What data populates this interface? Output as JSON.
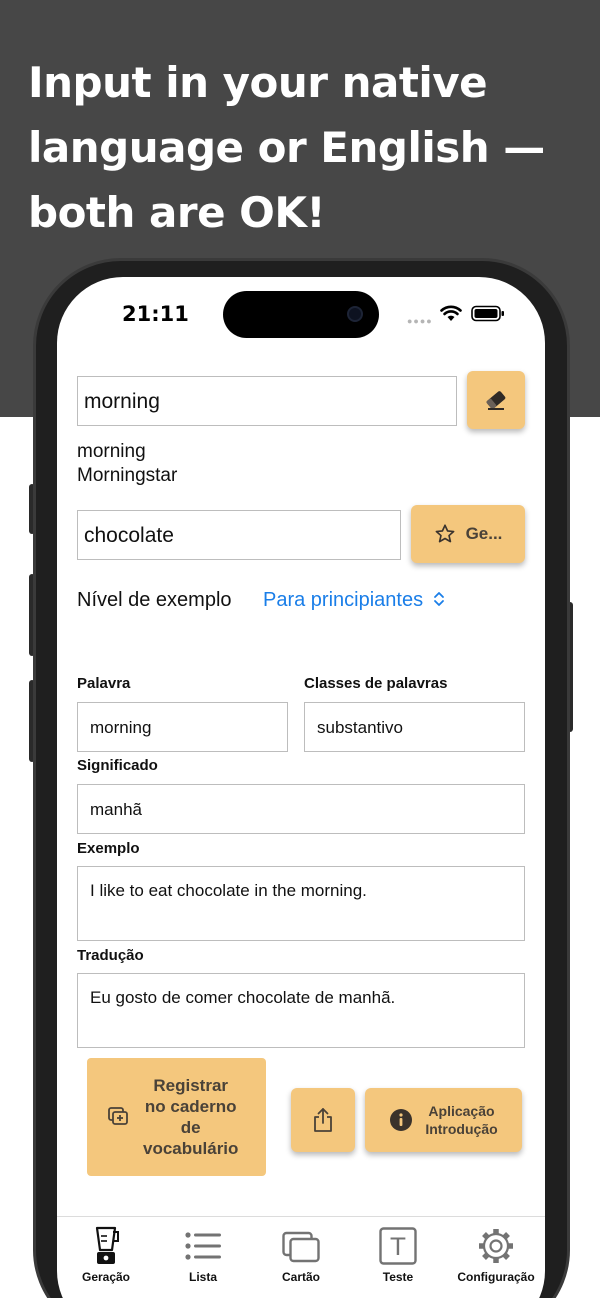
{
  "headline": {
    "line1": "Input in your native",
    "line2": "language or English —",
    "line3": "both are OK!"
  },
  "status_bar": {
    "time": "21:11",
    "signal": "●●●●"
  },
  "search": {
    "value": "morning",
    "suggestions": [
      "morning",
      "Morningstar"
    ]
  },
  "context": {
    "value": "chocolate",
    "generate_label": "Ge..."
  },
  "level": {
    "label": "Nível de exemplo",
    "value": "Para principiantes"
  },
  "form": {
    "word_label": "Palavra",
    "word_value": "morning",
    "class_label": "Classes de palavras",
    "class_value": "substantivo",
    "meaning_label": "Significado",
    "meaning_value": "manhã",
    "example_label": "Exemplo",
    "example_value": "I like to eat chocolate in the morning.",
    "translation_label": "Tradução",
    "translation_value": "Eu gosto de comer chocolate de manhã."
  },
  "actions": {
    "register_lines": [
      "Registrar",
      "no caderno",
      "de",
      "vocabulário"
    ],
    "intro_lines": [
      "Aplicação",
      "Introdução"
    ]
  },
  "tabs": [
    {
      "label": "Geração",
      "icon": "blender-icon"
    },
    {
      "label": "Lista",
      "icon": "list-icon"
    },
    {
      "label": "Cartão",
      "icon": "cards-icon"
    },
    {
      "label": "Teste",
      "icon": "text-box-icon",
      "glyph": "T"
    },
    {
      "label": "Configuração",
      "icon": "gear-icon"
    }
  ],
  "colors": {
    "accent": "#f4c77d",
    "link": "#1a7ee8",
    "band": "#474747"
  }
}
